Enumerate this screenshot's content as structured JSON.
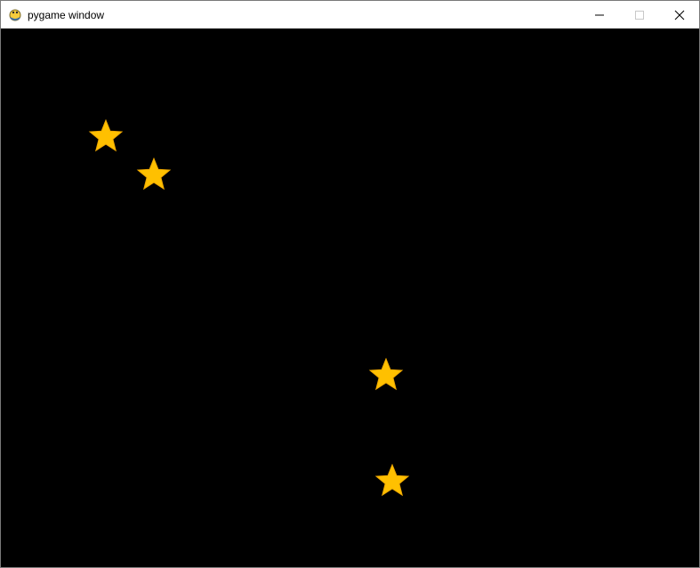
{
  "window": {
    "title": "pygame window",
    "app_icon": "pygame-snake-icon",
    "controls": [
      "minimize-icon",
      "maximize-icon",
      "close-icon"
    ]
  },
  "game": {
    "background_color": "#000000",
    "star_color": "#FFC000",
    "star_outline_color": "#F0A800",
    "star_count": 4
  }
}
